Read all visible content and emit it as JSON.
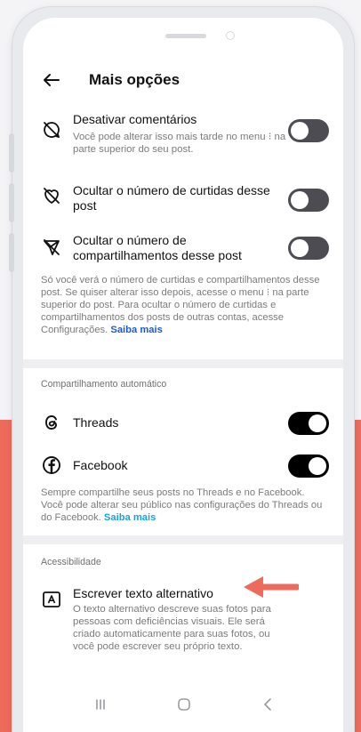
{
  "header": {
    "title": "Mais opções"
  },
  "rows": [
    {
      "id": "disable-comments",
      "icon": "comment-off-icon",
      "title": "Desativar comentários",
      "subtitle": "Você pode alterar isso mais tarde no menu ⁝ na parte superior do seu post.",
      "toggle": "off"
    },
    {
      "id": "hide-likes",
      "icon": "heart-off-icon",
      "title": "Ocultar o número de curtidas desse post",
      "toggle": "off"
    },
    {
      "id": "hide-shares",
      "icon": "share-off-icon",
      "title": "Ocultar o número de compartilhamentos desse post",
      "toggle": "off"
    }
  ],
  "visibility_note": {
    "text": "Só você verá o número de curtidas e compartilhamentos desse post. Se quiser alterar isso depois, acesse o menu ⁝ na parte superior do post. Para ocultar o número de curtidas e compartilhamentos dos posts de outras contas, acesse Configurações. ",
    "link": "Saiba mais"
  },
  "auto_share": {
    "label": "Compartilhamento automático",
    "items": [
      {
        "id": "threads",
        "icon": "threads-icon",
        "label": "Threads",
        "toggle": "on"
      },
      {
        "id": "facebook",
        "icon": "facebook-icon",
        "label": "Facebook",
        "toggle": "on"
      }
    ],
    "note": "Sempre compartilhe seus posts no Threads e no Facebook. Você pode alterar seu público nas configurações do Threads ou do Facebook. ",
    "link": "Saiba mais"
  },
  "accessibility": {
    "label": "Acessibilidade",
    "item": {
      "icon": "alt-text-icon",
      "title": "Escrever texto alternativo",
      "subtitle": "O texto alternativo descreve suas fotos para pessoas com deficiências visuais. Ele será criado automaticamente para suas fotos, ou você pode escrever seu próprio texto."
    }
  },
  "colors": {
    "accent_arrow": "#ee6b5c",
    "link": "#1f5bc8",
    "toggle_on": "#000000",
    "toggle_off": "#4c4c52"
  }
}
